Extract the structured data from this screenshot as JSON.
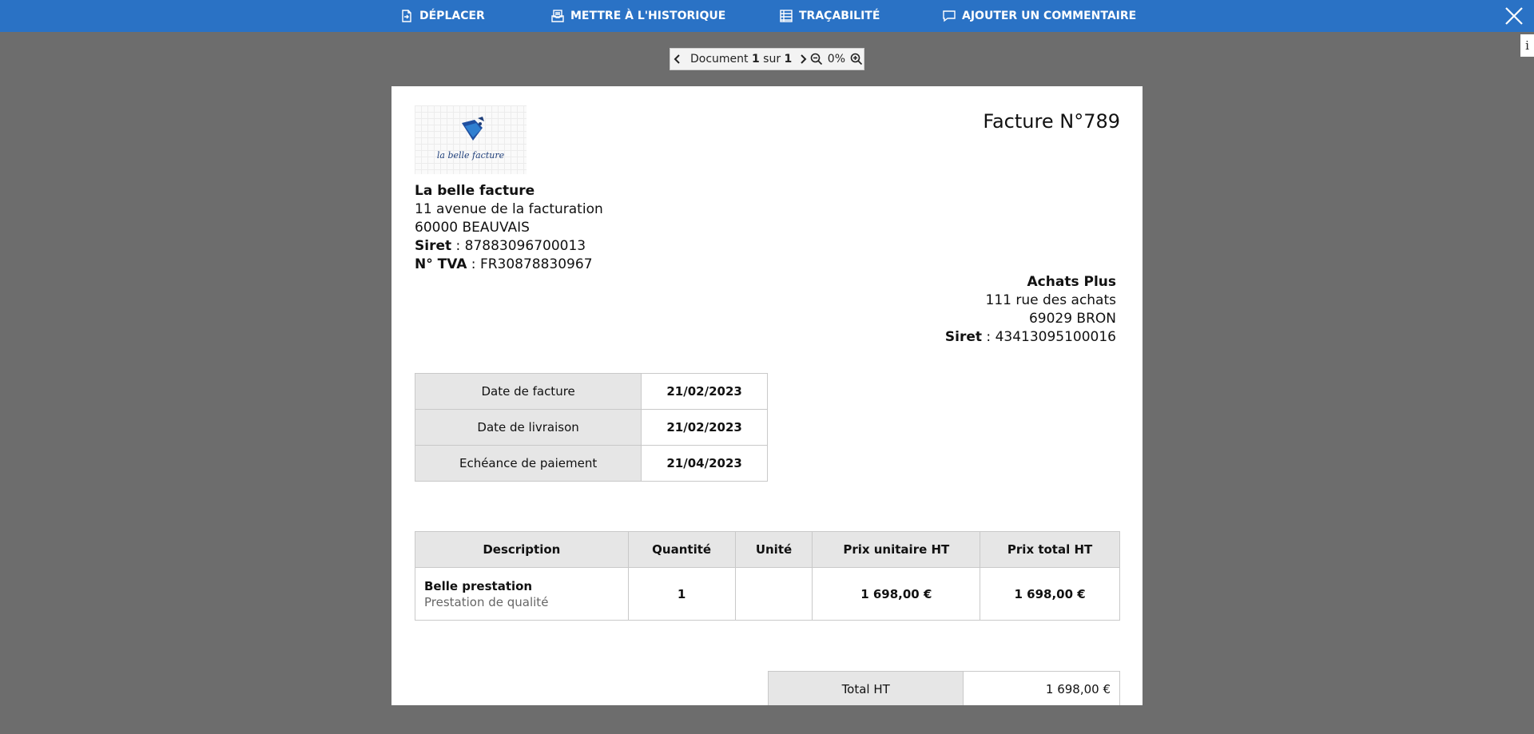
{
  "toolbar": {
    "move_label": "DÉPLACER",
    "history_label": "METTRE À L'HISTORIQUE",
    "traceability_label": "TRAÇABILITÉ",
    "comment_label": "AJOUTER UN COMMENTAIRE",
    "icons": [
      "move-document-icon",
      "archive-icon",
      "list-icon",
      "comment-icon",
      "close-icon"
    ],
    "background_color": "#2a72c5"
  },
  "info_tab": {
    "label": "i"
  },
  "viewer": {
    "doc_prefix": "Document",
    "doc_current": "1",
    "doc_of": "sur",
    "doc_total": "1",
    "zoom": "0%"
  },
  "invoice": {
    "logo_text": "la belle facture",
    "title": "Facture N°789",
    "seller": {
      "name": "La belle facture",
      "address1": "11 avenue de la facturation",
      "address2": "60000 BEAUVAIS",
      "siret_label": "Siret",
      "siret": " : 87883096700013",
      "vat_label": "N° TVA",
      "vat": " : FR30878830967"
    },
    "buyer": {
      "name": "Achats Plus",
      "address1": "111 rue des achats",
      "address2": "69029 BRON",
      "siret_label": "Siret",
      "siret": " : 43413095100016"
    },
    "dates": [
      {
        "label": "Date de facture",
        "value": "21/02/2023"
      },
      {
        "label": "Date de livraison",
        "value": "21/02/2023"
      },
      {
        "label": "Echéance de paiement",
        "value": "21/04/2023"
      }
    ],
    "items_headers": [
      "Description",
      "Quantité",
      "Unité",
      "Prix unitaire HT",
      "Prix total HT"
    ],
    "items": [
      {
        "title": "Belle prestation",
        "subtitle": "Prestation de qualité",
        "quantity": "1",
        "unit": "",
        "unit_price": "1 698,00 €",
        "total": "1 698,00 €"
      }
    ],
    "totals": [
      {
        "label": "Total HT",
        "value": "1 698,00 €"
      }
    ]
  }
}
